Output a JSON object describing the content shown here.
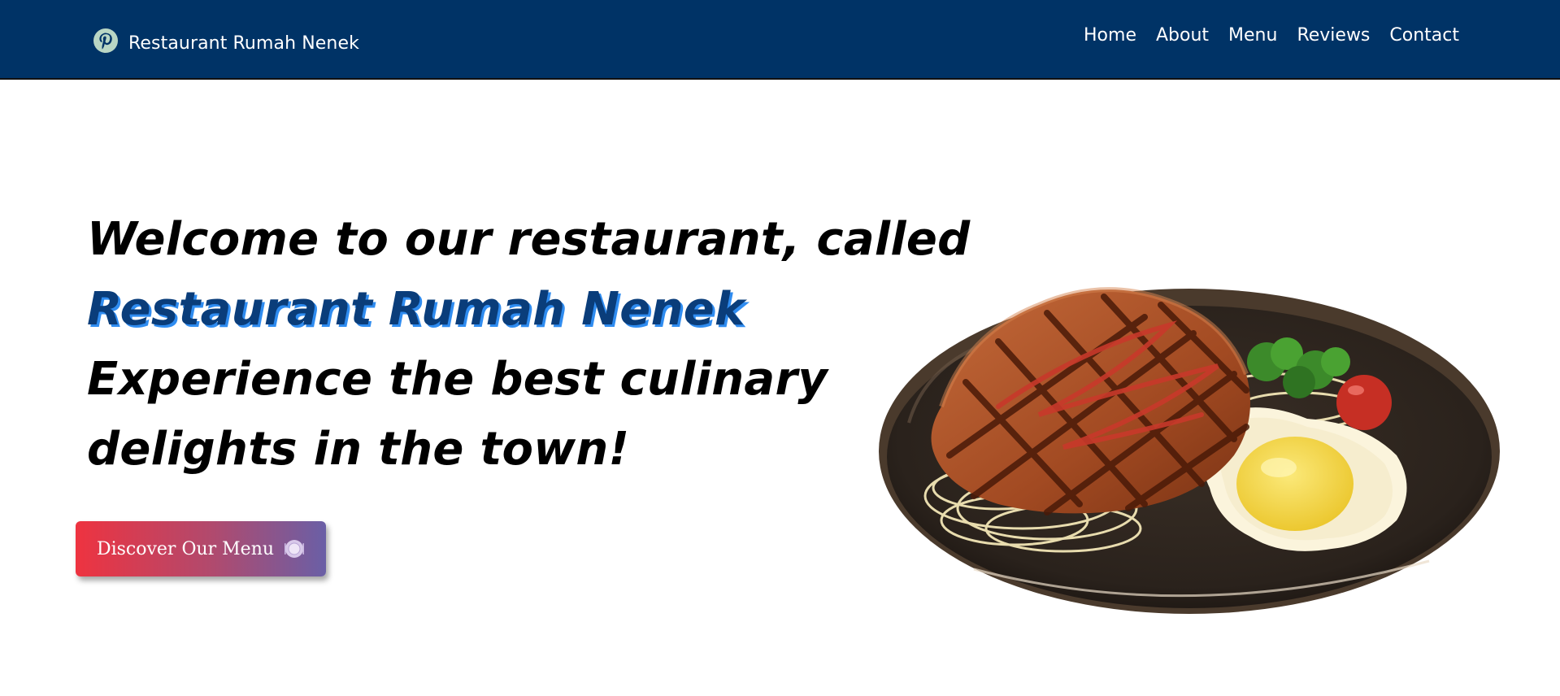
{
  "navbar": {
    "brand_icon": "pinterest-logo-icon",
    "brand_name": "Restaurant Rumah Nenek",
    "links": [
      {
        "label": "Home"
      },
      {
        "label": "About"
      },
      {
        "label": "Menu"
      },
      {
        "label": "Reviews"
      },
      {
        "label": "Contact"
      }
    ],
    "background_color": "#003366"
  },
  "hero": {
    "line1": "Welcome to our restaurant, called",
    "restaurant_name": "Restaurant Rumah Nenek",
    "line3": "Experience the best culinary",
    "line4": "delights in the town!",
    "cta_label": "Discover Our Menu",
    "cta_icon": "plate-icon",
    "image": "steak-with-egg-and-noodles-illustration"
  },
  "colors": {
    "name_highlight": "#0a3d7a",
    "name_shadow": "#2f8cf0",
    "cta_gradient_start": "#ee3340",
    "cta_gradient_end": "#6a5fa6"
  }
}
